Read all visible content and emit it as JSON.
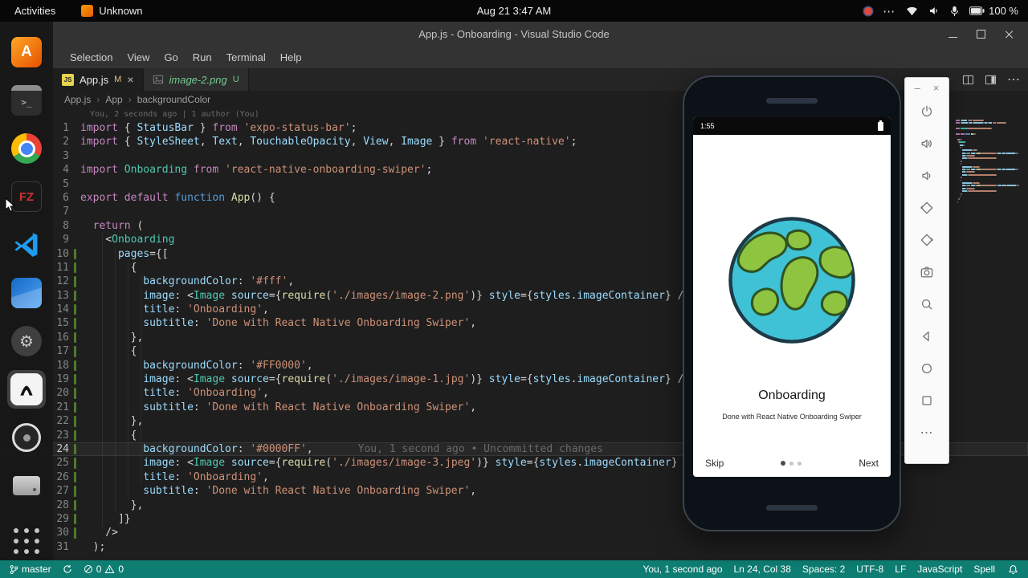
{
  "topbar": {
    "activities": "Activities",
    "app_name": "Unknown",
    "clock": "Aug 21  3:47 AM",
    "battery": "100 %"
  },
  "icons": {
    "close": "×",
    "more": "⋯",
    "chevron": "›",
    "minus": "–",
    "terminal_glyph": ">_",
    "filezilla_glyph": "FZ",
    "js_glyph": "JS",
    "orange_glyph": "A",
    "gear": "⚙",
    "ellipsis": "⋯"
  },
  "vscode": {
    "window_title": "App.js - Onboarding - Visual Studio Code",
    "menus": [
      "Selection",
      "View",
      "Go",
      "Run",
      "Terminal",
      "Help"
    ],
    "tabs": [
      {
        "label": "App.js",
        "badge": "M"
      },
      {
        "label": "image-2.png",
        "badge": "U"
      }
    ],
    "breadcrumb": [
      "App.js",
      "App",
      "backgroundColor"
    ],
    "blame_header": "You, 2 seconds ago | 1 author (You)",
    "editor": {
      "current_line": 24,
      "changed_lines": [
        10,
        30
      ],
      "lines": [
        {
          "n": 1,
          "t": [
            [
              "k",
              "import"
            ],
            [
              "p",
              " { "
            ],
            [
              "i",
              "StatusBar"
            ],
            [
              "p",
              " } "
            ],
            [
              "k",
              "from"
            ],
            [
              "p",
              " "
            ],
            [
              "s",
              "'expo-status-bar'"
            ],
            [
              "p",
              ";"
            ]
          ]
        },
        {
          "n": 2,
          "t": [
            [
              "k",
              "import"
            ],
            [
              "p",
              " { "
            ],
            [
              "i",
              "StyleSheet"
            ],
            [
              "p",
              ", "
            ],
            [
              "i",
              "Text"
            ],
            [
              "p",
              ", "
            ],
            [
              "i",
              "TouchableOpacity"
            ],
            [
              "p",
              ", "
            ],
            [
              "i",
              "View"
            ],
            [
              "p",
              ", "
            ],
            [
              "i",
              "Image"
            ],
            [
              "p",
              " } "
            ],
            [
              "k",
              "from"
            ],
            [
              "p",
              " "
            ],
            [
              "s",
              "'react-native'"
            ],
            [
              "p",
              ";"
            ]
          ]
        },
        {
          "n": 3,
          "t": []
        },
        {
          "n": 4,
          "t": [
            [
              "k",
              "import"
            ],
            [
              "p",
              " "
            ],
            [
              "t",
              "Onboarding"
            ],
            [
              "p",
              " "
            ],
            [
              "k",
              "from"
            ],
            [
              "p",
              " "
            ],
            [
              "s",
              "'react-native-onboarding-swiper'"
            ],
            [
              "p",
              ";"
            ]
          ]
        },
        {
          "n": 5,
          "t": []
        },
        {
          "n": 6,
          "t": [
            [
              "k",
              "export"
            ],
            [
              "p",
              " "
            ],
            [
              "k",
              "default"
            ],
            [
              "p",
              " "
            ],
            [
              "d",
              "function"
            ],
            [
              "p",
              " "
            ],
            [
              "f",
              "App"
            ],
            [
              "p",
              "() {"
            ]
          ]
        },
        {
          "n": 7,
          "t": []
        },
        {
          "n": 8,
          "t": [
            [
              "p",
              "  "
            ],
            [
              "k",
              "return"
            ],
            [
              "p",
              " ("
            ]
          ]
        },
        {
          "n": 9,
          "t": [
            [
              "p",
              "    <"
            ],
            [
              "t",
              "Onboarding"
            ]
          ]
        },
        {
          "n": 10,
          "t": [
            [
              "p",
              "      "
            ],
            [
              "i",
              "pages"
            ],
            [
              "p",
              "={["
            ]
          ]
        },
        {
          "n": 11,
          "t": [
            [
              "p",
              "        {"
            ]
          ]
        },
        {
          "n": 12,
          "t": [
            [
              "p",
              "          "
            ],
            [
              "i",
              "backgroundColor"
            ],
            [
              "p",
              ": "
            ],
            [
              "s",
              "'#fff'"
            ],
            [
              "p",
              ","
            ]
          ]
        },
        {
          "n": 13,
          "t": [
            [
              "p",
              "          "
            ],
            [
              "i",
              "image"
            ],
            [
              "p",
              ": <"
            ],
            [
              "t",
              "Image"
            ],
            [
              "p",
              " "
            ],
            [
              "i",
              "source"
            ],
            [
              "p",
              "={"
            ],
            [
              "f",
              "require"
            ],
            [
              "p",
              "("
            ],
            [
              "s",
              "'./images/image-2.png'"
            ],
            [
              "p",
              ")} "
            ],
            [
              "i",
              "style"
            ],
            [
              "p",
              "={"
            ],
            [
              "i",
              "styles"
            ],
            [
              "p",
              "."
            ],
            [
              "i",
              "imageContainer"
            ],
            [
              "p",
              "} />,"
            ]
          ]
        },
        {
          "n": 14,
          "t": [
            [
              "p",
              "          "
            ],
            [
              "i",
              "title"
            ],
            [
              "p",
              ": "
            ],
            [
              "s",
              "'Onboarding'"
            ],
            [
              "p",
              ","
            ]
          ]
        },
        {
          "n": 15,
          "t": [
            [
              "p",
              "          "
            ],
            [
              "i",
              "subtitle"
            ],
            [
              "p",
              ": "
            ],
            [
              "s",
              "'Done with React Native Onboarding Swiper'"
            ],
            [
              "p",
              ","
            ]
          ]
        },
        {
          "n": 16,
          "t": [
            [
              "p",
              "        },"
            ]
          ]
        },
        {
          "n": 17,
          "t": [
            [
              "p",
              "        {"
            ]
          ]
        },
        {
          "n": 18,
          "t": [
            [
              "p",
              "          "
            ],
            [
              "i",
              "backgroundColor"
            ],
            [
              "p",
              ": "
            ],
            [
              "s",
              "'#FF0000'"
            ],
            [
              "p",
              ","
            ]
          ]
        },
        {
          "n": 19,
          "t": [
            [
              "p",
              "          "
            ],
            [
              "i",
              "image"
            ],
            [
              "p",
              ": <"
            ],
            [
              "t",
              "Image"
            ],
            [
              "p",
              " "
            ],
            [
              "i",
              "source"
            ],
            [
              "p",
              "={"
            ],
            [
              "f",
              "require"
            ],
            [
              "p",
              "("
            ],
            [
              "s",
              "'./images/image-1.jpg'"
            ],
            [
              "p",
              ")} "
            ],
            [
              "i",
              "style"
            ],
            [
              "p",
              "={"
            ],
            [
              "i",
              "styles"
            ],
            [
              "p",
              "."
            ],
            [
              "i",
              "imageContainer"
            ],
            [
              "p",
              "} />,"
            ]
          ]
        },
        {
          "n": 20,
          "t": [
            [
              "p",
              "          "
            ],
            [
              "i",
              "title"
            ],
            [
              "p",
              ": "
            ],
            [
              "s",
              "'Onboarding'"
            ],
            [
              "p",
              ","
            ]
          ]
        },
        {
          "n": 21,
          "t": [
            [
              "p",
              "          "
            ],
            [
              "i",
              "subtitle"
            ],
            [
              "p",
              ": "
            ],
            [
              "s",
              "'Done with React Native Onboarding Swiper'"
            ],
            [
              "p",
              ","
            ]
          ]
        },
        {
          "n": 22,
          "t": [
            [
              "p",
              "        },"
            ]
          ]
        },
        {
          "n": 23,
          "t": [
            [
              "p",
              "        {"
            ]
          ]
        },
        {
          "n": 24,
          "t": [
            [
              "p",
              "          "
            ],
            [
              "i",
              "backgroundColor"
            ],
            [
              "p",
              ": "
            ],
            [
              "s",
              "'#0000FF'"
            ],
            [
              "p",
              ","
            ]
          ],
          "blame": "You, 1 second ago • Uncommitted changes"
        },
        {
          "n": 25,
          "t": [
            [
              "p",
              "          "
            ],
            [
              "i",
              "image"
            ],
            [
              "p",
              ": <"
            ],
            [
              "t",
              "Image"
            ],
            [
              "p",
              " "
            ],
            [
              "i",
              "source"
            ],
            [
              "p",
              "={"
            ],
            [
              "f",
              "require"
            ],
            [
              "p",
              "("
            ],
            [
              "s",
              "'./images/image-3.jpeg'"
            ],
            [
              "p",
              ")} "
            ],
            [
              "i",
              "style"
            ],
            [
              "p",
              "={"
            ],
            [
              "i",
              "styles"
            ],
            [
              "p",
              "."
            ],
            [
              "i",
              "imageContainer"
            ],
            [
              "p",
              "} />,"
            ]
          ]
        },
        {
          "n": 26,
          "t": [
            [
              "p",
              "          "
            ],
            [
              "i",
              "title"
            ],
            [
              "p",
              ": "
            ],
            [
              "s",
              "'Onboarding'"
            ],
            [
              "p",
              ","
            ]
          ]
        },
        {
          "n": 27,
          "t": [
            [
              "p",
              "          "
            ],
            [
              "i",
              "subtitle"
            ],
            [
              "p",
              ": "
            ],
            [
              "s",
              "'Done with React Native Onboarding Swiper'"
            ],
            [
              "p",
              ","
            ]
          ]
        },
        {
          "n": 28,
          "t": [
            [
              "p",
              "        },"
            ]
          ]
        },
        {
          "n": 29,
          "t": [
            [
              "p",
              "      ]}"
            ]
          ]
        },
        {
          "n": 30,
          "t": [
            [
              "p",
              "    />"
            ]
          ]
        },
        {
          "n": 31,
          "t": [
            [
              "p",
              "  );"
            ]
          ]
        }
      ]
    },
    "statusbar": {
      "branch": "master",
      "errors": "0",
      "warnings": "0",
      "right_items": [
        "You, 1 second ago",
        "Ln 24, Col 38",
        "Spaces: 2",
        "UTF-8",
        "LF",
        "JavaScript",
        "Spell"
      ]
    }
  },
  "emulator": {
    "status_clock": "1:55",
    "page": {
      "title": "Onboarding",
      "subtitle": "Done with React Native Onboarding Swiper",
      "skip": "Skip",
      "next": "Next"
    },
    "colors": {
      "globe_water": "#3fc2d6",
      "globe_land": "#8fc441",
      "statusbar_accent": "#0e7d72"
    }
  }
}
